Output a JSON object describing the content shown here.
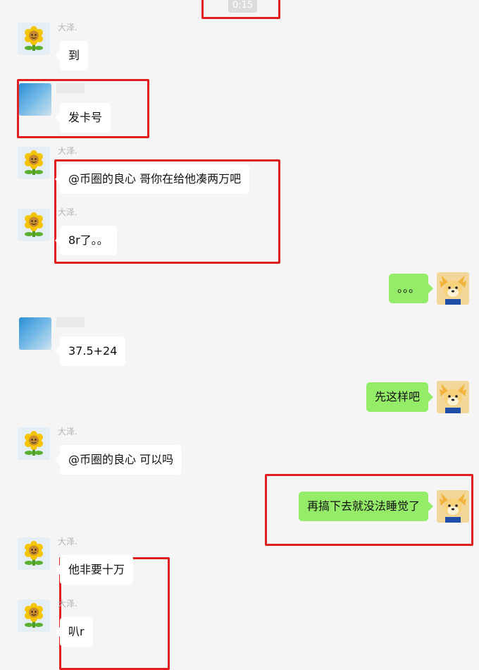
{
  "top": {
    "timestamp": "0:15"
  },
  "messages": [
    {
      "id": "m1",
      "sender": "大泽.",
      "text": "到",
      "side": "left",
      "avatar": "sunflower-icon"
    },
    {
      "id": "m2",
      "sender": "",
      "text": "发卡号",
      "side": "left",
      "avatar": "blurred-avatar"
    },
    {
      "id": "m3",
      "sender": "大泽.",
      "text": "@币圈的良心 哥你在给他凑两万吧",
      "side": "left",
      "avatar": "sunflower-icon"
    },
    {
      "id": "m4",
      "sender": "大泽.",
      "text": "8r了。。",
      "side": "left",
      "avatar": "sunflower-icon"
    },
    {
      "id": "m5",
      "sender": "",
      "text": "。。。",
      "side": "right",
      "avatar": "dog-icon"
    },
    {
      "id": "m6",
      "sender": "",
      "text": "37.5+24",
      "side": "left",
      "avatar": "blurred-avatar"
    },
    {
      "id": "m7",
      "sender": "",
      "text": "先这样吧",
      "side": "right",
      "avatar": "dog-icon"
    },
    {
      "id": "m8",
      "sender": "大泽.",
      "text": "@币圈的良心 可以吗",
      "side": "left",
      "avatar": "sunflower-icon"
    },
    {
      "id": "m9",
      "sender": "",
      "text": "再搞下去就没法睡觉了",
      "side": "right",
      "avatar": "dog-icon"
    },
    {
      "id": "m10",
      "sender": "大泽.",
      "text": "他非要十万",
      "side": "left",
      "avatar": "sunflower-icon"
    },
    {
      "id": "m11",
      "sender": "大泽.",
      "text": "叭r",
      "side": "left",
      "avatar": "sunflower-icon"
    }
  ],
  "colors": {
    "background": "#f5f5f5",
    "bubble_self": "#95ec69",
    "bubble_other": "#ffffff",
    "highlight_box": "#e02020"
  }
}
